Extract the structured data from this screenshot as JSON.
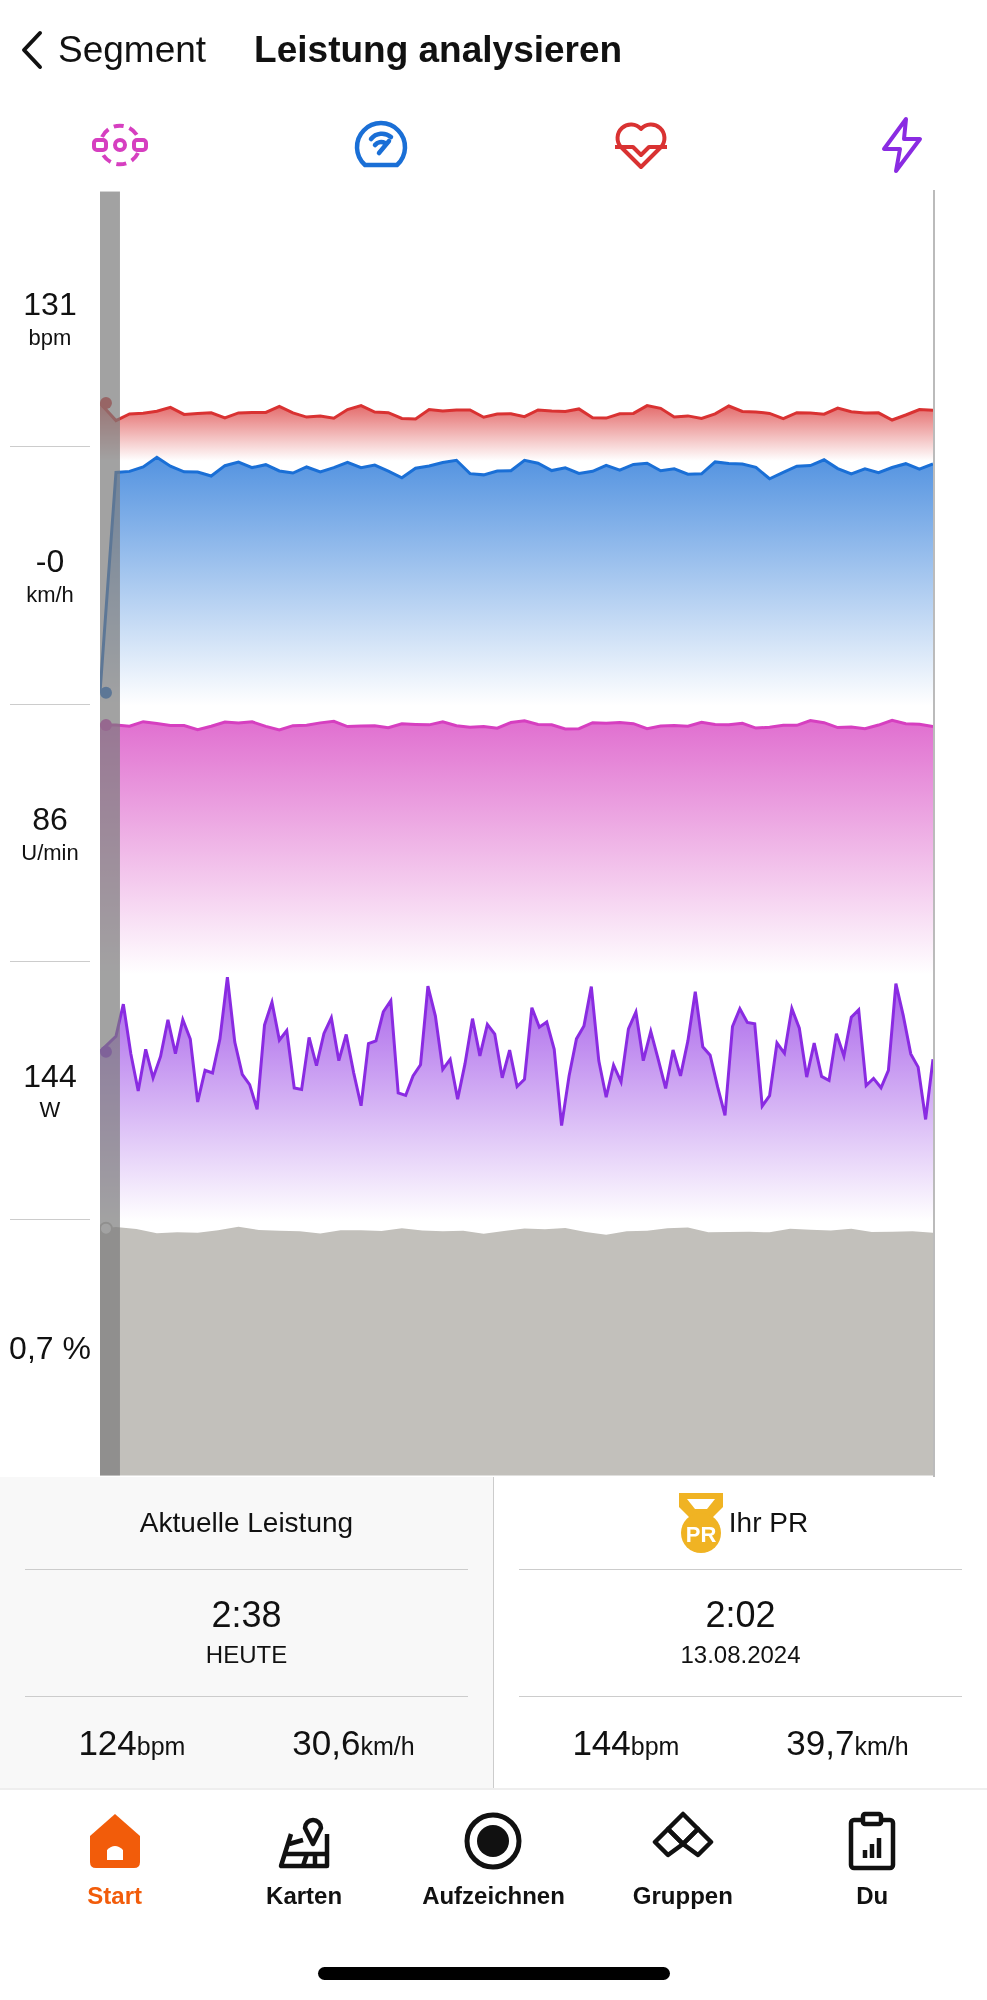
{
  "header": {
    "back_label": "Segment",
    "title": "Leistung analysieren"
  },
  "metric_icons": [
    {
      "kind": "cadence",
      "color": "#d63fc0"
    },
    {
      "kind": "speed",
      "color": "#1a6fd6"
    },
    {
      "kind": "heart_rate",
      "color": "#d93232"
    },
    {
      "kind": "power",
      "color": "#8a2be2"
    }
  ],
  "chart_rows": [
    {
      "kind": "heart_rate",
      "value": "131",
      "unit": "bpm",
      "color": "#d93232"
    },
    {
      "kind": "speed",
      "value": "-0",
      "unit": "km/h",
      "color": "#1a6fd6"
    },
    {
      "kind": "cadence",
      "value": "86",
      "unit": "U/min",
      "color": "#d63fc0"
    },
    {
      "kind": "power",
      "value": "144",
      "unit": "W",
      "color": "#8a2be2"
    },
    {
      "kind": "grade",
      "value": "0,7 %",
      "color": "#c2c0bb"
    }
  ],
  "comparison": [
    {
      "title": "Aktuelle Leistung",
      "time": "2:38",
      "date": "HEUTE",
      "heart_rate": "124",
      "heart_rate_unit": "bpm",
      "speed": "30,6",
      "speed_unit": "km/h"
    },
    {
      "badge": "PR",
      "title": "Ihr PR",
      "time": "2:02",
      "date": "13.08.2024",
      "heart_rate": "144",
      "heart_rate_unit": "bpm",
      "speed": "39,7",
      "speed_unit": "km/h"
    }
  ],
  "tab_bar": [
    {
      "kind": "home",
      "label": "Start",
      "selected": true
    },
    {
      "kind": "maps",
      "label": "Karten",
      "selected": false
    },
    {
      "kind": "record",
      "label": "Aufzeichnen",
      "selected": false
    },
    {
      "kind": "groups",
      "label": "Gruppen",
      "selected": false
    },
    {
      "kind": "profile",
      "label": "Du",
      "selected": false
    }
  ]
}
